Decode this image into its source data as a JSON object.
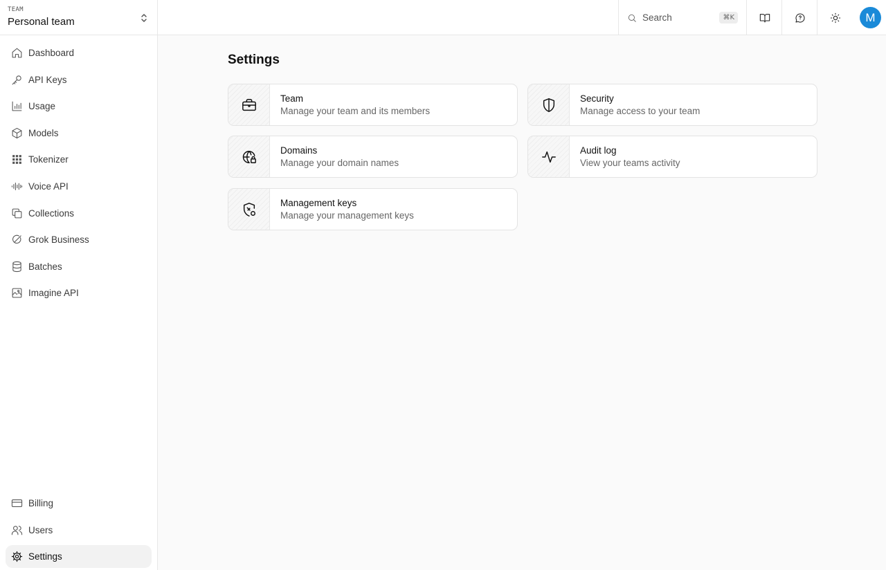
{
  "team": {
    "caption": "TEAM",
    "name": "Personal team"
  },
  "sidebar": {
    "items": [
      {
        "label": "Dashboard",
        "icon": "home-icon"
      },
      {
        "label": "API Keys",
        "icon": "key-icon"
      },
      {
        "label": "Usage",
        "icon": "bar-chart-icon"
      },
      {
        "label": "Models",
        "icon": "cube-icon"
      },
      {
        "label": "Tokenizer",
        "icon": "grid-icon"
      },
      {
        "label": "Voice API",
        "icon": "audio-wave-icon"
      },
      {
        "label": "Collections",
        "icon": "copy-icon"
      },
      {
        "label": "Grok Business",
        "icon": "grok-logo-icon"
      },
      {
        "label": "Batches",
        "icon": "database-icon"
      },
      {
        "label": "Imagine API",
        "icon": "image-icon"
      }
    ],
    "bottom_items": [
      {
        "label": "Billing",
        "icon": "credit-card-icon"
      },
      {
        "label": "Users",
        "icon": "users-icon"
      },
      {
        "label": "Settings",
        "icon": "gear-icon",
        "active": true
      }
    ]
  },
  "topbar": {
    "search": {
      "label": "Search",
      "shortcut": "⌘K"
    },
    "buttons": [
      "book-icon",
      "chat-help-icon",
      "sun-icon"
    ],
    "avatar": {
      "initial": "M",
      "color": "#1a8ad8"
    }
  },
  "main": {
    "title": "Settings",
    "cards": [
      {
        "title": "Team",
        "description": "Manage your team and its members",
        "icon": "briefcase-icon"
      },
      {
        "title": "Security",
        "description": "Manage access to your team",
        "icon": "shield-icon"
      },
      {
        "title": "Domains",
        "description": "Manage your domain names",
        "icon": "globe-lock-icon"
      },
      {
        "title": "Audit log",
        "description": "View your teams activity",
        "icon": "activity-icon"
      },
      {
        "title": "Management keys",
        "description": "Manage your management keys",
        "icon": "shield-key-icon"
      }
    ]
  },
  "colors": {
    "accent": "#1a8ad8",
    "active_bg": "#f2f2f2",
    "border": "#e7e7e7"
  }
}
